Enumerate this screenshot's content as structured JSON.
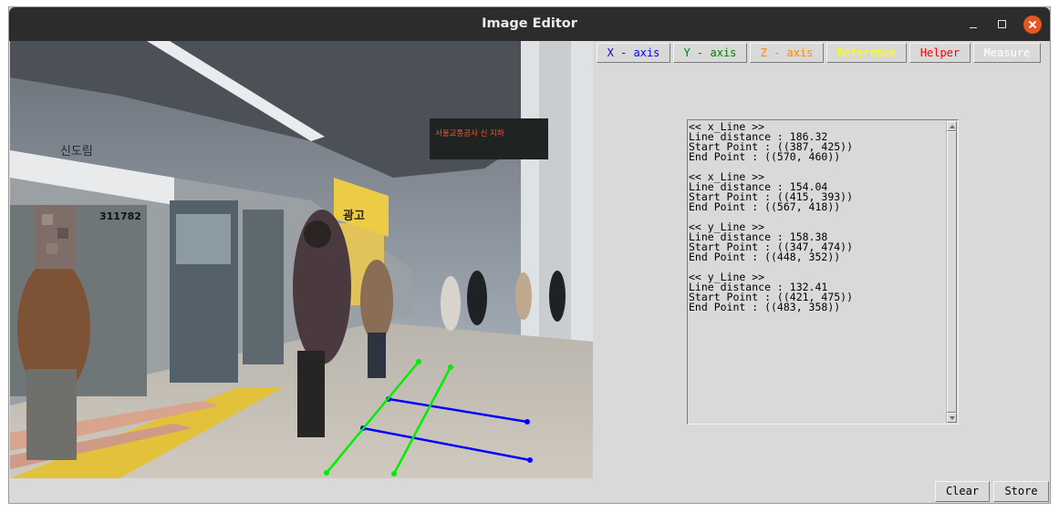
{
  "window": {
    "title": "Image Editor"
  },
  "toolbar": {
    "x_axis": "X - axis",
    "y_axis": "Y - axis",
    "z_axis": "Z - axis",
    "reference": "Reference",
    "helper": "Helper",
    "measure": "Measure"
  },
  "colors": {
    "x_axis": "#0000ff",
    "y_axis": "#008000",
    "z_axis": "#ff8c00",
    "reference": "#ffff00",
    "helper": "#ff0000",
    "measure": "#ffffff"
  },
  "output": {
    "text": "<< x_Line >>\nLine distance : 186.32\nStart Point : ((387, 425))\nEnd Point : ((570, 460))\n\n<< x_Line >>\nLine distance : 154.04\nStart Point : ((415, 393))\nEnd Point : ((567, 418))\n\n<< y_Line >>\nLine distance : 158.38\nStart Point : ((347, 474))\nEnd Point : ((448, 352))\n\n<< y_Line >>\nLine distance : 132.41\nStart Point : ((421, 475))\nEnd Point : ((483, 358))"
  },
  "lines": [
    {
      "type": "x_Line",
      "color": "#0000ff",
      "start": [
        387,
        425
      ],
      "end": [
        570,
        460
      ]
    },
    {
      "type": "x_Line",
      "color": "#0000ff",
      "start": [
        415,
        393
      ],
      "end": [
        567,
        418
      ]
    },
    {
      "type": "y_Line",
      "color": "#00ee00",
      "start": [
        347,
        474
      ],
      "end": [
        448,
        352
      ]
    },
    {
      "type": "y_Line",
      "color": "#00ee00",
      "start": [
        421,
        475
      ],
      "end": [
        483,
        358
      ]
    }
  ],
  "photo": {
    "station_sign": "신도림",
    "car_number": "311782",
    "led_text": "서울교통공사 신 지하",
    "banner": "광고"
  },
  "actions": {
    "clear": "Clear",
    "store": "Store"
  }
}
